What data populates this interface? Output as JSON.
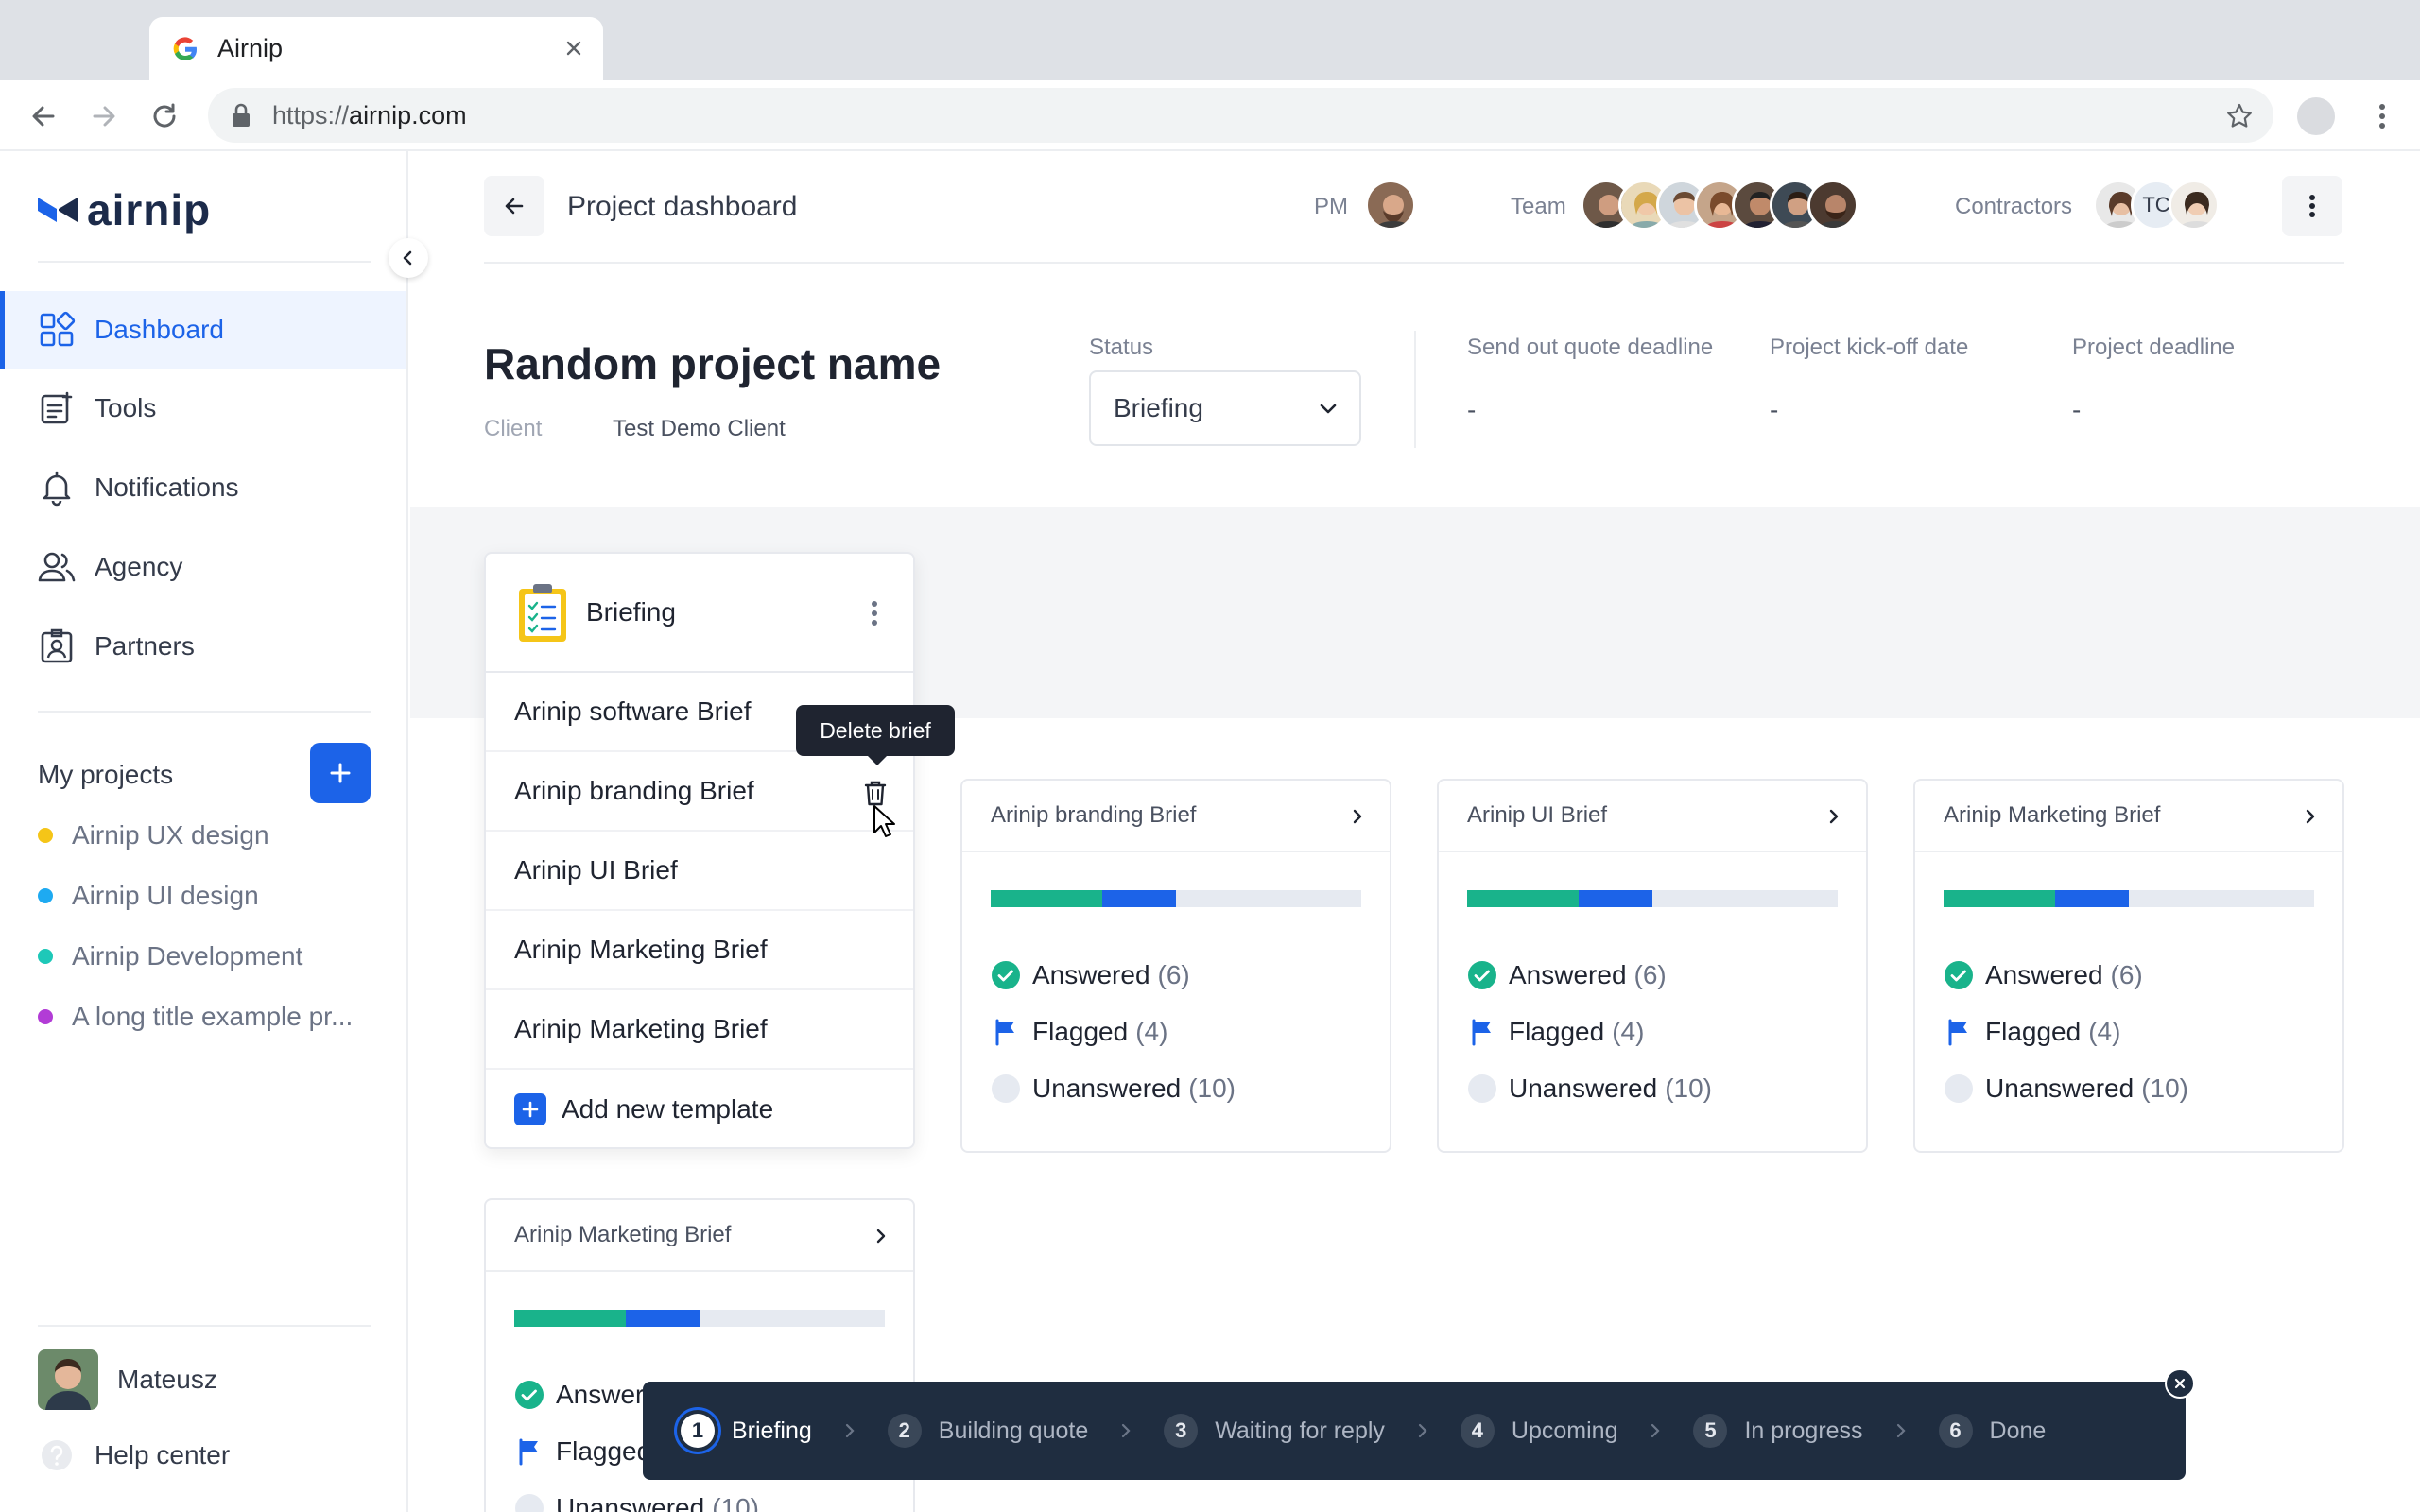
{
  "browser": {
    "tab_title": "Airnip",
    "url_prefix": "https://",
    "url_host": "airnip.com"
  },
  "sidebar": {
    "logo": "airnip",
    "nav": [
      {
        "label": "Dashboard",
        "icon": "dashboard-icon",
        "active": true
      },
      {
        "label": "Tools",
        "icon": "tools-icon",
        "active": false
      },
      {
        "label": "Notifications",
        "icon": "bell-icon",
        "active": false
      },
      {
        "label": "Agency",
        "icon": "people-icon",
        "active": false
      },
      {
        "label": "Partners",
        "icon": "badge-icon",
        "active": false
      }
    ],
    "my_projects_label": "My projects",
    "projects": [
      {
        "label": "Airnip UX design",
        "color": "#f5c518"
      },
      {
        "label": "Airnip UI design",
        "color": "#1eaaf1"
      },
      {
        "label": "Airnip Development",
        "color": "#1ec8b8"
      },
      {
        "label": "A long title example pr...",
        "color": "#b23cd6"
      }
    ],
    "user_name": "Mateusz",
    "help_label": "Help center"
  },
  "header": {
    "title": "Project dashboard",
    "pm_label": "PM",
    "team_label": "Team",
    "contractors_label": "Contractors",
    "contractor_initials": "TC"
  },
  "project": {
    "name": "Random project name",
    "client_label": "Client",
    "client_value": "Test Demo Client",
    "status_label": "Status",
    "status_value": "Briefing",
    "dates": [
      {
        "label": "Send out quote deadline",
        "value": "-"
      },
      {
        "label": "Project kick-off date",
        "value": "-"
      },
      {
        "label": "Project deadline",
        "value": "-"
      }
    ]
  },
  "briefing_panel": {
    "title": "Briefing",
    "items": [
      "Arinip software Brief",
      "Arinip branding Brief",
      "Arinip UI Brief",
      "Arinip Marketing Brief",
      "Arinip Marketing Brief"
    ],
    "add_label": "Add new template",
    "tooltip": "Delete brief"
  },
  "brief_cards": [
    {
      "title": "Arinip branding Brief",
      "answered": "Answered",
      "answered_count": "(6)",
      "flagged": "Flagged",
      "flagged_count": "(4)",
      "unanswered": "Unanswered",
      "unanswered_count": "(10)",
      "progress_answered": 0.3,
      "progress_flagged": 0.2
    },
    {
      "title": "Arinip UI Brief",
      "answered": "Answered",
      "answered_count": "(6)",
      "flagged": "Flagged",
      "flagged_count": "(4)",
      "unanswered": "Unanswered",
      "unanswered_count": "(10)",
      "progress_answered": 0.3,
      "progress_flagged": 0.2
    },
    {
      "title": "Arinip Marketing Brief",
      "answered": "Answered",
      "answered_count": "(6)",
      "flagged": "Flagged",
      "flagged_count": "(4)",
      "unanswered": "Unanswered",
      "unanswered_count": "(10)",
      "progress_answered": 0.3,
      "progress_flagged": 0.2
    },
    {
      "title": "Arinip Marketing Brief",
      "answered": "Answer",
      "answered_count": "",
      "flagged": "Flagged",
      "flagged_count": "",
      "unanswered": "Unanswered",
      "unanswered_count": "(10)",
      "progress_answered": 0.3,
      "progress_flagged": 0.2
    }
  ],
  "stepper": [
    {
      "num": "1",
      "label": "Briefing",
      "active": true
    },
    {
      "num": "2",
      "label": "Building quote",
      "active": false
    },
    {
      "num": "3",
      "label": "Waiting for reply",
      "active": false
    },
    {
      "num": "4",
      "label": "Upcoming",
      "active": false
    },
    {
      "num": "5",
      "label": "In progress",
      "active": false
    },
    {
      "num": "6",
      "label": "Done",
      "active": false
    }
  ],
  "colors": {
    "accent": "#1c63e8",
    "answered": "#19b38b",
    "stepper_bg": "#1f2d40"
  }
}
